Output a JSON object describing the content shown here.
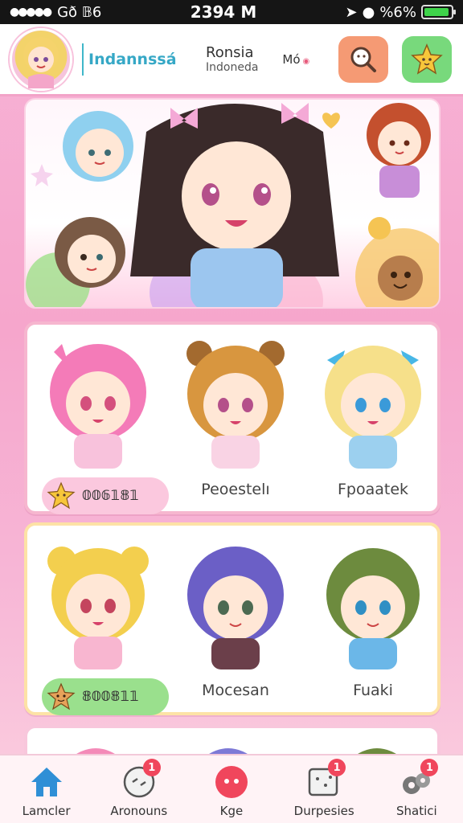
{
  "status_bar": {
    "carrier": "Gð 𝔹6",
    "time": "2394 M",
    "battery_text": "%6%",
    "battery_level": 0.95
  },
  "header": {
    "brand": "Indannssá",
    "region_title": "Ronsia",
    "region_sub": "Indoneda",
    "mode_label": "Mó"
  },
  "characters_row1": [
    {
      "name": "𝟘𝟘𝟞𝟙𝟠𝟙",
      "badge": "pink",
      "badge_icon": "star-icon",
      "hair": "#f47bb8",
      "eyes": "#d4507d"
    },
    {
      "name": "Peoestelı",
      "hair": "#d8963f",
      "eyes": "#b4508a"
    },
    {
      "name": "Fpoaatek",
      "hair": "#f6e08a",
      "eyes": "#3a9ad9"
    }
  ],
  "characters_row2": [
    {
      "name": "𝟠𝟘𝟘𝟠𝟙𝟙",
      "badge": "green",
      "badge_icon": "mascot-icon",
      "hair": "#f3cf4e",
      "eyes": "#c4455e"
    },
    {
      "name": "Mocesan",
      "hair": "#6b5fc6",
      "eyes": "#4c6a52"
    },
    {
      "name": "Fuaki",
      "hair": "#6d8b3e",
      "eyes": "#2f8fc4"
    }
  ],
  "bottom_nav": [
    {
      "label": "Lamcler",
      "icon": "home-icon",
      "badge": ""
    },
    {
      "label": "Aronouns",
      "icon": "chat-icon",
      "badge": "1"
    },
    {
      "label": "Kge",
      "icon": "record-icon",
      "badge": ""
    },
    {
      "label": "Durpesies",
      "icon": "board-icon",
      "badge": "1"
    },
    {
      "label": "Shatici",
      "icon": "gear-cluster-icon",
      "badge": "1"
    }
  ],
  "colors": {
    "accent": "#36a8c6",
    "search_button": "#f59a74",
    "mascot_button": "#78d97c",
    "home_active": "#2f8fd6"
  }
}
